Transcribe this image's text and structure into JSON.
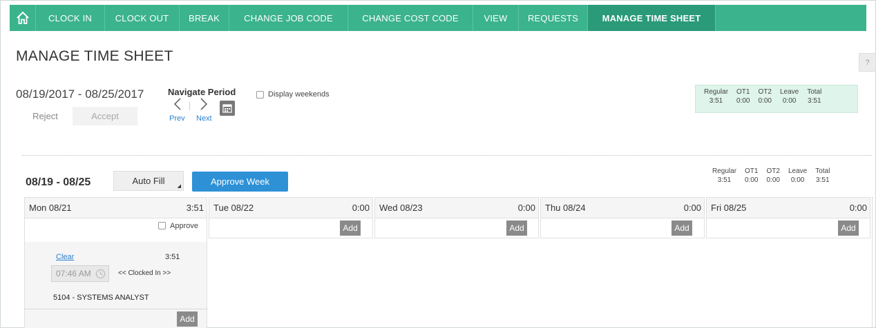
{
  "nav": {
    "home_icon": "home-icon",
    "items": [
      {
        "label": "CLOCK IN",
        "active": false
      },
      {
        "label": "CLOCK OUT",
        "active": false
      },
      {
        "label": "BREAK",
        "active": false
      },
      {
        "label": "CHANGE JOB CODE",
        "active": false
      },
      {
        "label": "CHANGE COST CODE",
        "active": false
      },
      {
        "label": "VIEW",
        "active": false
      },
      {
        "label": "REQUESTS",
        "active": false
      },
      {
        "label": "MANAGE TIME SHEET",
        "active": true
      }
    ]
  },
  "page": {
    "title": "MANAGE TIME SHEET",
    "help": "?",
    "period_range": "08/19/2017 - 08/25/2017",
    "reject_label": "Reject",
    "accept_label": "Accept",
    "navigate_period_label": "Navigate Period",
    "prev_label": "Prev",
    "next_label": "Next",
    "display_weekends_label": "Display weekends",
    "display_weekends_checked": false
  },
  "totals_period": {
    "columns": [
      {
        "header": "Regular",
        "value": "3:51"
      },
      {
        "header": "OT1",
        "value": "0:00"
      },
      {
        "header": "OT2",
        "value": "0:00"
      },
      {
        "header": "Leave",
        "value": "0:00"
      },
      {
        "header": "Total",
        "value": "3:51"
      }
    ]
  },
  "week": {
    "label": "08/19 - 08/25",
    "autofill_label": "Auto Fill",
    "approve_week_label": "Approve Week",
    "totals": [
      {
        "header": "Regular",
        "value": "3:51"
      },
      {
        "header": "OT1",
        "value": "0:00"
      },
      {
        "header": "OT2",
        "value": "0:00"
      },
      {
        "header": "Leave",
        "value": "0:00"
      },
      {
        "header": "Total",
        "value": "3:51"
      }
    ]
  },
  "days": [
    {
      "label": "Mon 08/21",
      "total": "3:51"
    },
    {
      "label": "Tue 08/22",
      "total": "0:00"
    },
    {
      "label": "Wed 08/23",
      "total": "0:00"
    },
    {
      "label": "Thu 08/24",
      "total": "0:00"
    },
    {
      "label": "Fri 08/25",
      "total": "0:00"
    }
  ],
  "monday": {
    "approve_label": "Approve",
    "approve_checked": false,
    "clear_label": "Clear",
    "entry_duration": "3:51",
    "time_value": "07:46 AM",
    "clocked_in_label": "<< Clocked In >>",
    "job_code": "5104 - SYSTEMS ANALYST"
  },
  "add_label": "Add",
  "colors": {
    "nav_bg": "#3bb38c",
    "nav_active": "#2a9a78",
    "approve_week_bg": "#2e91d6",
    "totals_bg": "#dff4ea"
  }
}
